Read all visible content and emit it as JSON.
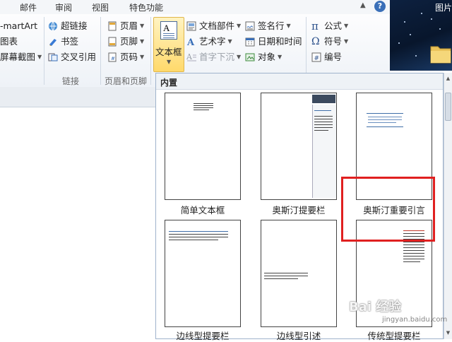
{
  "tabs": [
    "邮件",
    "审阅",
    "视图",
    "特色功能"
  ],
  "ribbon": {
    "illustrations": {
      "smartart": "-martArt",
      "chart": "图表",
      "screenshot": "屏幕截图"
    },
    "links": {
      "hyperlink": "超链接",
      "bookmark": "书签",
      "cross_reference": "交叉引用",
      "group_label": "链接"
    },
    "header_footer": {
      "header": "页眉",
      "footer": "页脚",
      "page_number": "页码",
      "group_label": "页眉和页脚"
    },
    "text": {
      "text_box": "文本框",
      "quick_parts": "文档部件",
      "wordart": "艺术字",
      "drop_cap": "首字下沉",
      "signature_line": "签名行",
      "date_time": "日期和时间",
      "object": "对象"
    },
    "symbols": {
      "equation": "公式",
      "symbol": "符号",
      "number": "编号"
    }
  },
  "desktop": {
    "label": "图片"
  },
  "gallery": {
    "section_title": "内置",
    "items": [
      {
        "label": "简单文本框"
      },
      {
        "label": "奥斯汀提要栏"
      },
      {
        "label": "奥斯汀重要引言"
      },
      {
        "label": "边线型提要栏"
      },
      {
        "label": "边线型引述"
      },
      {
        "label": "传统型提要栏"
      }
    ]
  },
  "watermark": {
    "main": "Bai 经验",
    "sub": "jingyan.baidu.com"
  },
  "colors": {
    "accent": "#3f6ea8",
    "highlight": "#e02020",
    "selected_button": "#ffd96b"
  }
}
